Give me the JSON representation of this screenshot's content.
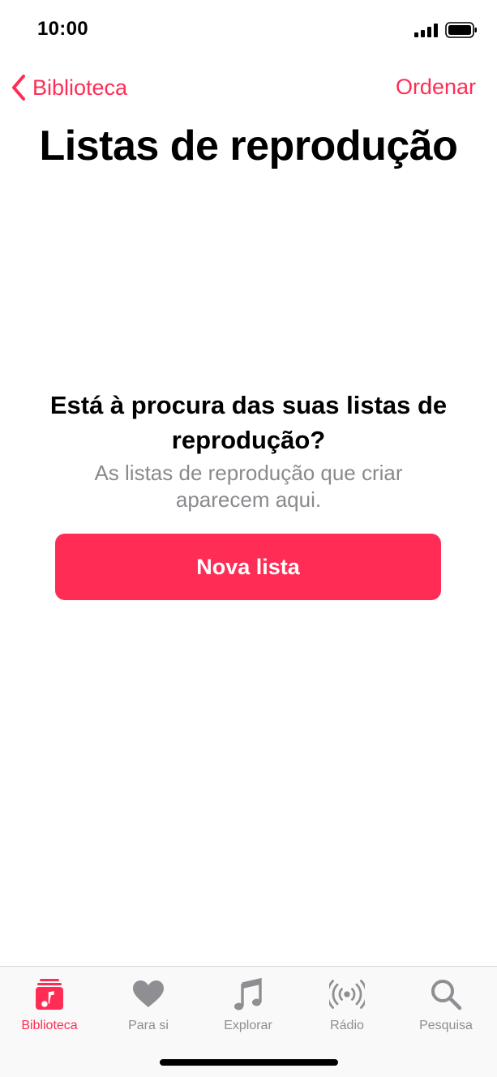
{
  "status_bar": {
    "time": "10:00"
  },
  "nav": {
    "back_label": "Biblioteca",
    "sort_label": "Ordenar"
  },
  "page": {
    "title": "Listas de reprodução"
  },
  "empty_state": {
    "heading": "Está à procura das suas listas de reprodução?",
    "subtitle": "As listas de reprodução que criar aparecem aqui.",
    "button_label": "Nova lista"
  },
  "tab_bar": {
    "items": [
      {
        "label": "Biblioteca",
        "icon": "library-icon",
        "active": true
      },
      {
        "label": "Para si",
        "icon": "heart-icon",
        "active": false
      },
      {
        "label": "Explorar",
        "icon": "music-note-icon",
        "active": false
      },
      {
        "label": "Rádio",
        "icon": "radio-icon",
        "active": false
      },
      {
        "label": "Pesquisa",
        "icon": "search-icon",
        "active": false
      }
    ]
  },
  "colors": {
    "accent": "#ff2d55",
    "inactive": "#8e8e93",
    "subtitle": "#8a8a8e"
  }
}
